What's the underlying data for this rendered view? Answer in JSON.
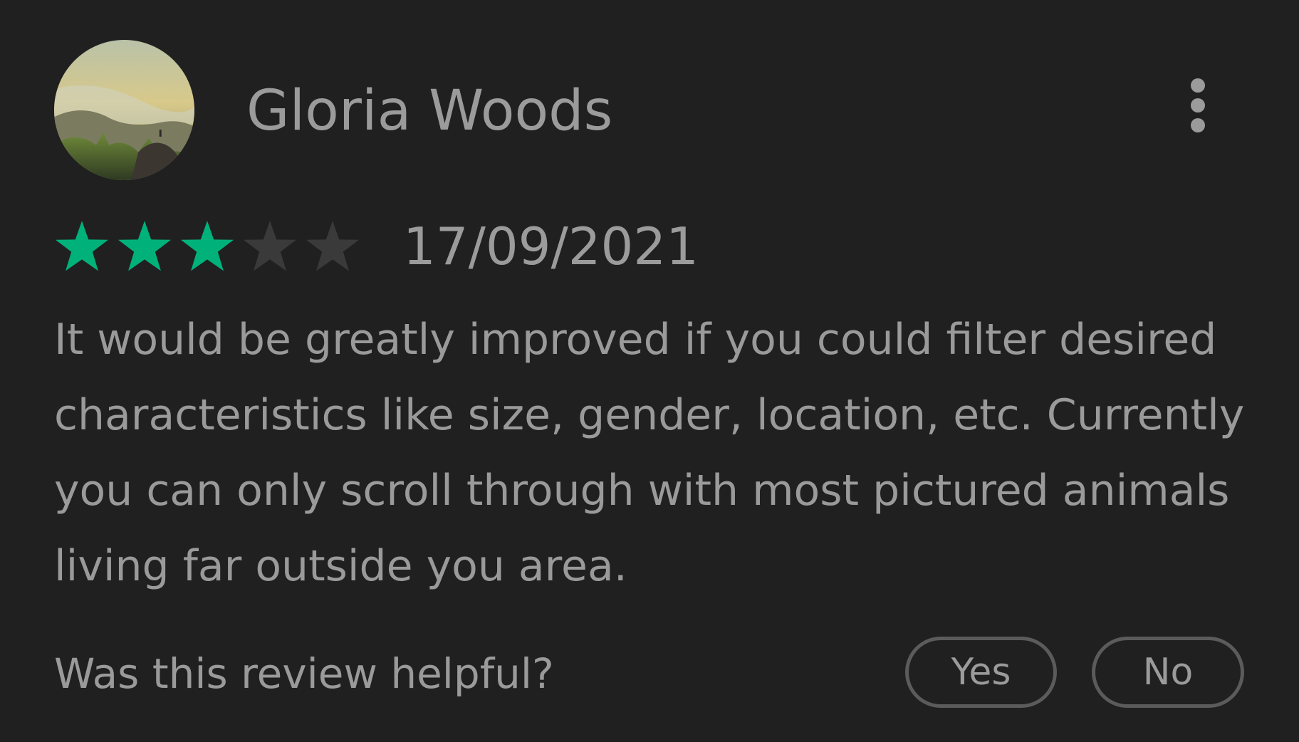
{
  "review": {
    "reviewer_name": "Gloria Woods",
    "avatar_icon": "landscape-photo-avatar",
    "more_icon": "more-vertical-icon",
    "rating": 3,
    "rating_max": 5,
    "date": "17/09/2021",
    "text": "It would be greatly improved if you could filter desired characteristics like size, gender, location, etc. Currently you can only scroll through with most pictured animals living far outside you area."
  },
  "helpful": {
    "question": "Was this review helpful?",
    "yes_label": "Yes",
    "no_label": "No"
  },
  "colors": {
    "background": "#202020",
    "text": "#9a9a9a",
    "star_filled": "#00b27a",
    "star_empty": "#3a3a3a",
    "button_border": "#5b5b5b"
  }
}
